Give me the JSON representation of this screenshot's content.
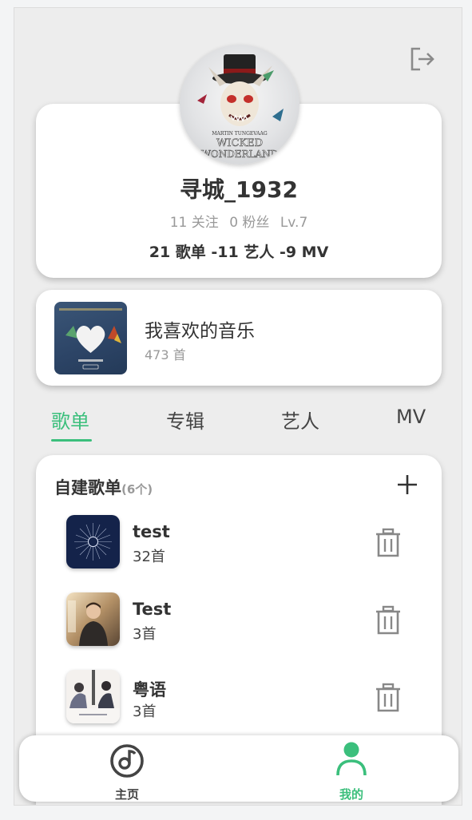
{
  "header": {
    "logout_icon": "logout-icon"
  },
  "profile": {
    "avatar_text_line1": "MARTIN TUNGEVAAG",
    "avatar_text_line2": "WICKED",
    "avatar_text_line3": "WONDERLAND",
    "username": "寻城_1932",
    "following": "11 关注",
    "followers": "0 粉丝",
    "level": "Lv.7",
    "counts": "21 歌单 -11 艺人 -9 MV"
  },
  "favorites": {
    "title": "我喜欢的音乐",
    "count": "473 首"
  },
  "tabs": [
    {
      "label": "歌单",
      "active": true
    },
    {
      "label": "专辑",
      "active": false
    },
    {
      "label": "艺人",
      "active": false
    },
    {
      "label": "MV",
      "active": false
    }
  ],
  "playlists": {
    "title": "自建歌单",
    "count": "(6个)",
    "items": [
      {
        "name": "test",
        "count": "32首"
      },
      {
        "name": "Test",
        "count": "3首"
      },
      {
        "name": "粤语",
        "count": "3首"
      }
    ]
  },
  "nav": [
    {
      "label": "主页",
      "icon": "music-disc-icon",
      "active": false
    },
    {
      "label": "我的",
      "icon": "user-icon",
      "active": true
    }
  ],
  "colors": {
    "accent": "#3bbf7c",
    "text": "#333333",
    "muted": "#999999"
  }
}
